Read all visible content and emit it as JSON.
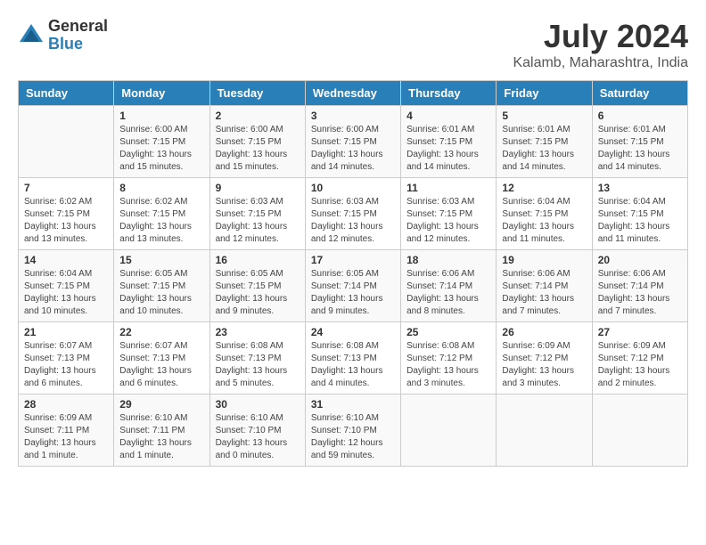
{
  "header": {
    "logo_general": "General",
    "logo_blue": "Blue",
    "month_year": "July 2024",
    "location": "Kalamb, Maharashtra, India"
  },
  "days_of_week": [
    "Sunday",
    "Monday",
    "Tuesday",
    "Wednesday",
    "Thursday",
    "Friday",
    "Saturday"
  ],
  "weeks": [
    [
      {
        "day": "",
        "info": ""
      },
      {
        "day": "1",
        "info": "Sunrise: 6:00 AM\nSunset: 7:15 PM\nDaylight: 13 hours\nand 15 minutes."
      },
      {
        "day": "2",
        "info": "Sunrise: 6:00 AM\nSunset: 7:15 PM\nDaylight: 13 hours\nand 15 minutes."
      },
      {
        "day": "3",
        "info": "Sunrise: 6:00 AM\nSunset: 7:15 PM\nDaylight: 13 hours\nand 14 minutes."
      },
      {
        "day": "4",
        "info": "Sunrise: 6:01 AM\nSunset: 7:15 PM\nDaylight: 13 hours\nand 14 minutes."
      },
      {
        "day": "5",
        "info": "Sunrise: 6:01 AM\nSunset: 7:15 PM\nDaylight: 13 hours\nand 14 minutes."
      },
      {
        "day": "6",
        "info": "Sunrise: 6:01 AM\nSunset: 7:15 PM\nDaylight: 13 hours\nand 14 minutes."
      }
    ],
    [
      {
        "day": "7",
        "info": "Sunrise: 6:02 AM\nSunset: 7:15 PM\nDaylight: 13 hours\nand 13 minutes."
      },
      {
        "day": "8",
        "info": "Sunrise: 6:02 AM\nSunset: 7:15 PM\nDaylight: 13 hours\nand 13 minutes."
      },
      {
        "day": "9",
        "info": "Sunrise: 6:03 AM\nSunset: 7:15 PM\nDaylight: 13 hours\nand 12 minutes."
      },
      {
        "day": "10",
        "info": "Sunrise: 6:03 AM\nSunset: 7:15 PM\nDaylight: 13 hours\nand 12 minutes."
      },
      {
        "day": "11",
        "info": "Sunrise: 6:03 AM\nSunset: 7:15 PM\nDaylight: 13 hours\nand 12 minutes."
      },
      {
        "day": "12",
        "info": "Sunrise: 6:04 AM\nSunset: 7:15 PM\nDaylight: 13 hours\nand 11 minutes."
      },
      {
        "day": "13",
        "info": "Sunrise: 6:04 AM\nSunset: 7:15 PM\nDaylight: 13 hours\nand 11 minutes."
      }
    ],
    [
      {
        "day": "14",
        "info": "Sunrise: 6:04 AM\nSunset: 7:15 PM\nDaylight: 13 hours\nand 10 minutes."
      },
      {
        "day": "15",
        "info": "Sunrise: 6:05 AM\nSunset: 7:15 PM\nDaylight: 13 hours\nand 10 minutes."
      },
      {
        "day": "16",
        "info": "Sunrise: 6:05 AM\nSunset: 7:15 PM\nDaylight: 13 hours\nand 9 minutes."
      },
      {
        "day": "17",
        "info": "Sunrise: 6:05 AM\nSunset: 7:14 PM\nDaylight: 13 hours\nand 9 minutes."
      },
      {
        "day": "18",
        "info": "Sunrise: 6:06 AM\nSunset: 7:14 PM\nDaylight: 13 hours\nand 8 minutes."
      },
      {
        "day": "19",
        "info": "Sunrise: 6:06 AM\nSunset: 7:14 PM\nDaylight: 13 hours\nand 7 minutes."
      },
      {
        "day": "20",
        "info": "Sunrise: 6:06 AM\nSunset: 7:14 PM\nDaylight: 13 hours\nand 7 minutes."
      }
    ],
    [
      {
        "day": "21",
        "info": "Sunrise: 6:07 AM\nSunset: 7:13 PM\nDaylight: 13 hours\nand 6 minutes."
      },
      {
        "day": "22",
        "info": "Sunrise: 6:07 AM\nSunset: 7:13 PM\nDaylight: 13 hours\nand 6 minutes."
      },
      {
        "day": "23",
        "info": "Sunrise: 6:08 AM\nSunset: 7:13 PM\nDaylight: 13 hours\nand 5 minutes."
      },
      {
        "day": "24",
        "info": "Sunrise: 6:08 AM\nSunset: 7:13 PM\nDaylight: 13 hours\nand 4 minutes."
      },
      {
        "day": "25",
        "info": "Sunrise: 6:08 AM\nSunset: 7:12 PM\nDaylight: 13 hours\nand 3 minutes."
      },
      {
        "day": "26",
        "info": "Sunrise: 6:09 AM\nSunset: 7:12 PM\nDaylight: 13 hours\nand 3 minutes."
      },
      {
        "day": "27",
        "info": "Sunrise: 6:09 AM\nSunset: 7:12 PM\nDaylight: 13 hours\nand 2 minutes."
      }
    ],
    [
      {
        "day": "28",
        "info": "Sunrise: 6:09 AM\nSunset: 7:11 PM\nDaylight: 13 hours\nand 1 minute."
      },
      {
        "day": "29",
        "info": "Sunrise: 6:10 AM\nSunset: 7:11 PM\nDaylight: 13 hours\nand 1 minute."
      },
      {
        "day": "30",
        "info": "Sunrise: 6:10 AM\nSunset: 7:10 PM\nDaylight: 13 hours\nand 0 minutes."
      },
      {
        "day": "31",
        "info": "Sunrise: 6:10 AM\nSunset: 7:10 PM\nDaylight: 12 hours\nand 59 minutes."
      },
      {
        "day": "",
        "info": ""
      },
      {
        "day": "",
        "info": ""
      },
      {
        "day": "",
        "info": ""
      }
    ]
  ]
}
